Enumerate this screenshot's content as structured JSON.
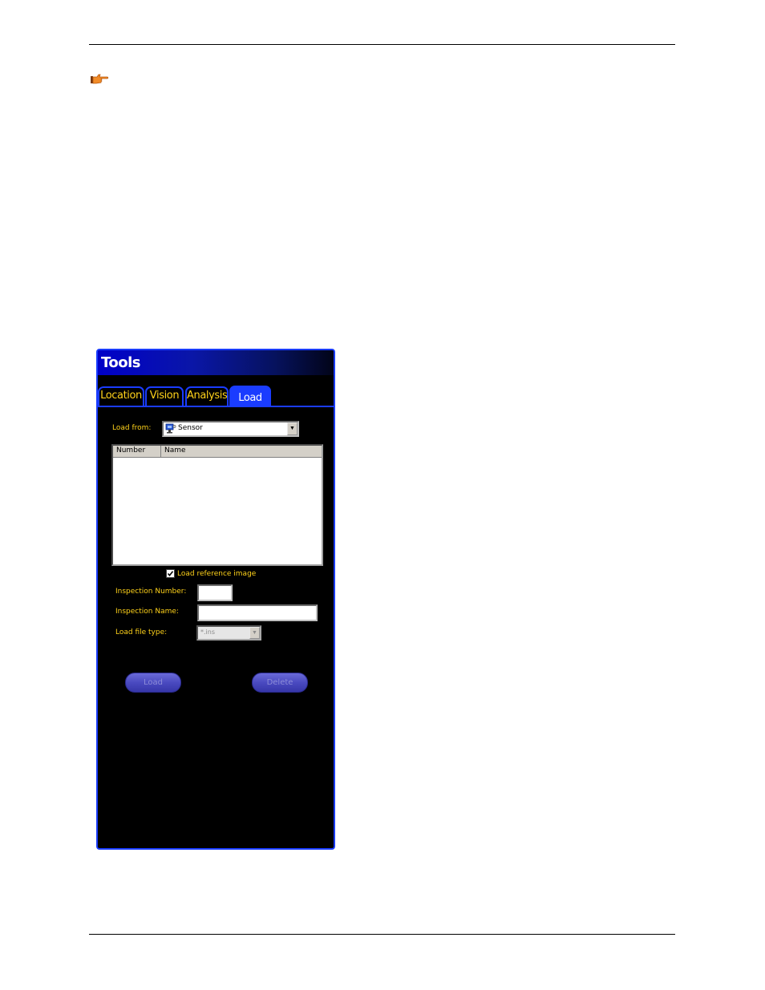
{
  "note": {
    "icon": "pointing-hand-icon",
    "icon_color": "#f28c28"
  },
  "tools_window": {
    "title": "Tools",
    "accent_color": "#1a3cff",
    "label_color": "#ffd21a",
    "tabs": [
      {
        "label": "Location",
        "active": false
      },
      {
        "label": "Vision",
        "active": false
      },
      {
        "label": "Analysis",
        "active": false
      },
      {
        "label": "Load",
        "active": true
      }
    ],
    "load_from": {
      "label": "Load from:",
      "value": "Sensor",
      "icon": "sensor-icon"
    },
    "table": {
      "columns": [
        "Number",
        "Name"
      ],
      "rows": []
    },
    "load_reference_image": {
      "label": "Load reference image",
      "checked": true
    },
    "inspection_number": {
      "label": "Inspection Number:",
      "value": ""
    },
    "inspection_name": {
      "label": "Inspection Name:",
      "value": ""
    },
    "load_file_type": {
      "label": "Load file type:",
      "value": "*.ins",
      "enabled": false
    },
    "buttons": {
      "load": "Load",
      "delete": "Delete",
      "enabled": false
    }
  }
}
